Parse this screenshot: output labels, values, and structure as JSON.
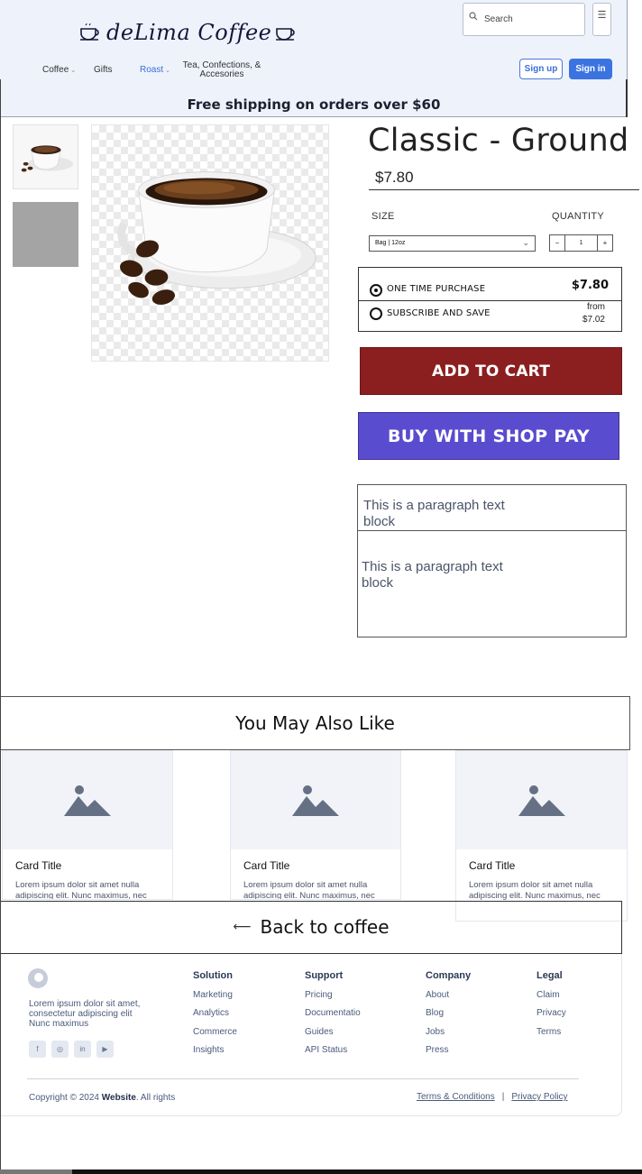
{
  "brand": {
    "name": "deLima Coffee"
  },
  "search": {
    "placeholder": "Search"
  },
  "menu_icon": "☰",
  "nav": {
    "items": [
      {
        "label": "Coffee",
        "has_dropdown": true
      },
      {
        "label": "Gifts",
        "has_dropdown": false
      },
      {
        "label": "Roast",
        "has_dropdown": true,
        "active": true
      },
      {
        "label": "Tea, Confections, & Accesories",
        "has_dropdown": false
      }
    ],
    "signup_label": "Sign up",
    "signin_label": "Sign in"
  },
  "banner": {
    "text": "Free shipping on orders over $60"
  },
  "product": {
    "title": "Classic - Ground",
    "price": "$7.80",
    "size_label": "SIZE",
    "size_value": "Bag | 12oz",
    "quantity_label": "QUANTITY",
    "quantity_value": "1",
    "qty_minus": "−",
    "qty_plus": "+",
    "purchase_options": [
      {
        "label": "ONE TIME PURCHASE",
        "price": "$7.80",
        "selected": true
      },
      {
        "label": "SUBSCRIBE AND SAVE",
        "price_prefix": "from",
        "price": "$7.02",
        "selected": false
      }
    ],
    "add_to_cart_label": "ADD TO CART",
    "shop_pay_label": "BUY WITH SHOP PAY",
    "paragraph_1": "This is a paragraph text block",
    "paragraph_2": "This is a paragraph text block"
  },
  "related": {
    "heading": "You May Also Like",
    "cards": [
      {
        "title": "Card Title",
        "body": "Lorem ipsum dolor sit amet nulla adipiscing elit. Nunc maximus, nec"
      },
      {
        "title": "Card Title",
        "body": "Lorem ipsum dolor sit amet nulla adipiscing elit. Nunc maximus, nec"
      },
      {
        "title": "Card Title",
        "body": "Lorem ipsum dolor sit amet nulla adipiscing elit. Nunc maximus, nec"
      }
    ]
  },
  "back_link": {
    "arrow": "⟵",
    "label": "Back to coffee"
  },
  "footer": {
    "description": "Lorem ipsum dolor sit amet, consectetur adipiscing elit Nunc maximus",
    "social_icons": [
      "facebook-icon",
      "instagram-icon",
      "linkedin-icon",
      "youtube-icon"
    ],
    "columns": [
      {
        "heading": "Solution",
        "links": [
          "Marketing",
          "Analytics",
          "Commerce",
          "Insights"
        ]
      },
      {
        "heading": "Support",
        "links": [
          "Pricing",
          "Documentatio",
          "Guides",
          "API Status"
        ]
      },
      {
        "heading": "Company",
        "links": [
          "About",
          "Blog",
          "Jobs",
          "Press"
        ]
      },
      {
        "heading": "Legal",
        "links": [
          "Claim",
          "Privacy",
          "Terms"
        ]
      }
    ],
    "copyright_prefix": "Copyright © 2024",
    "copyright_site": "Website",
    "copyright_suffix": ". All rights",
    "terms_label": "Terms & Conditions",
    "separator": "|",
    "privacy_label": "Privacy Policy"
  },
  "colors": {
    "accent_blue": "#3b74e0",
    "add_to_cart": "#8b1f1f",
    "shop_pay": "#5a4ccf",
    "header_bg": "#eef2fa"
  }
}
